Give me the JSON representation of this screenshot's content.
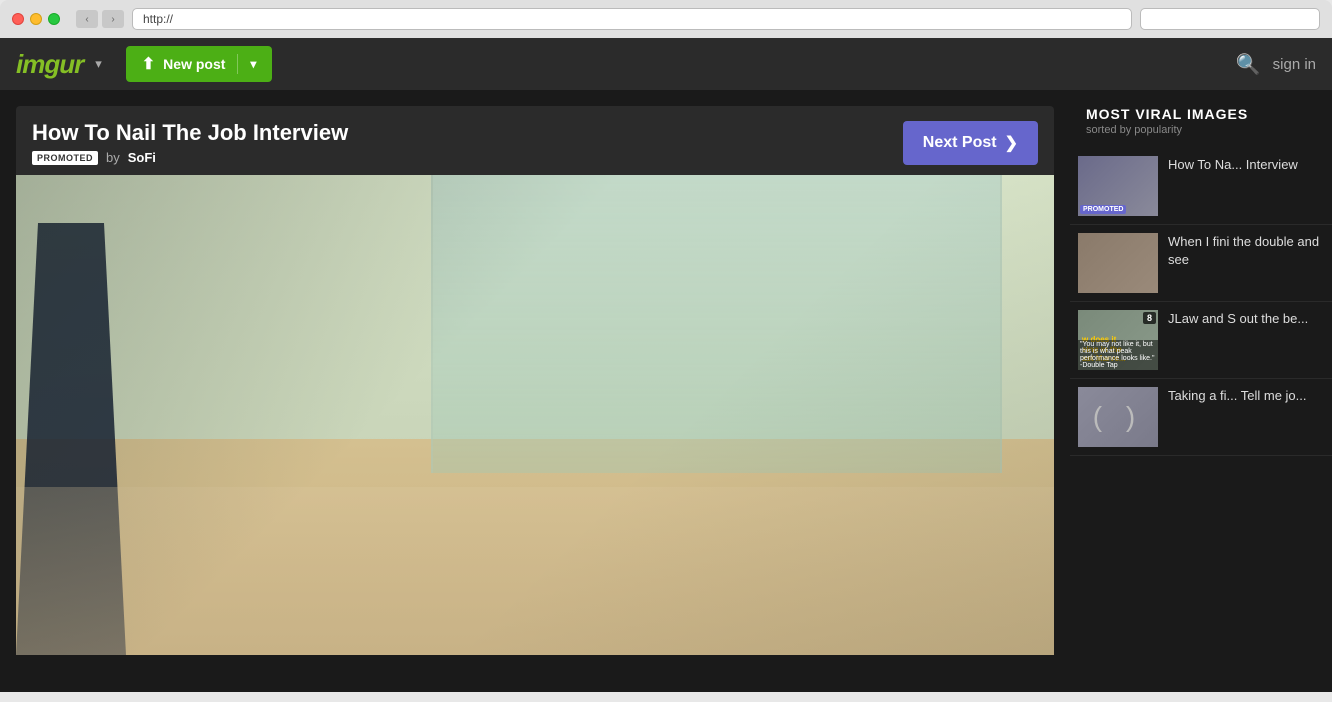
{
  "window": {
    "url": "http://",
    "search_placeholder": ""
  },
  "nav": {
    "logo": "imgur",
    "logo_dropdown": "▾",
    "new_post_label": "New post",
    "search_icon": "🔍",
    "sign_in_label": "sign in"
  },
  "post": {
    "title": "How To Nail The Job Interview",
    "promoted_badge": "PROMOTED",
    "by_text": "by",
    "author": "SoFi",
    "next_post_label": "Next Post",
    "next_post_arrow": "❯"
  },
  "sidebar": {
    "title": "MOST VIRAL IMAGES",
    "subtitle": "sorted by popularity",
    "items": [
      {
        "id": "item-1",
        "text": "How To Na... Interview",
        "promoted": true,
        "badge": null,
        "thumb_color": "#5a5a7a"
      },
      {
        "id": "item-2",
        "text": "When I fini the double and see",
        "promoted": false,
        "badge": null,
        "thumb_color": "#7a5a5a"
      },
      {
        "id": "item-3",
        "text": "JLaw and S out the be...",
        "promoted": false,
        "badge": "8",
        "thumb_color": "#5a6a5a"
      },
      {
        "id": "item-4",
        "text": "Taking a fi... Tell me jo...",
        "promoted": false,
        "badge": null,
        "thumb_color": "#6a6a8a"
      }
    ]
  }
}
